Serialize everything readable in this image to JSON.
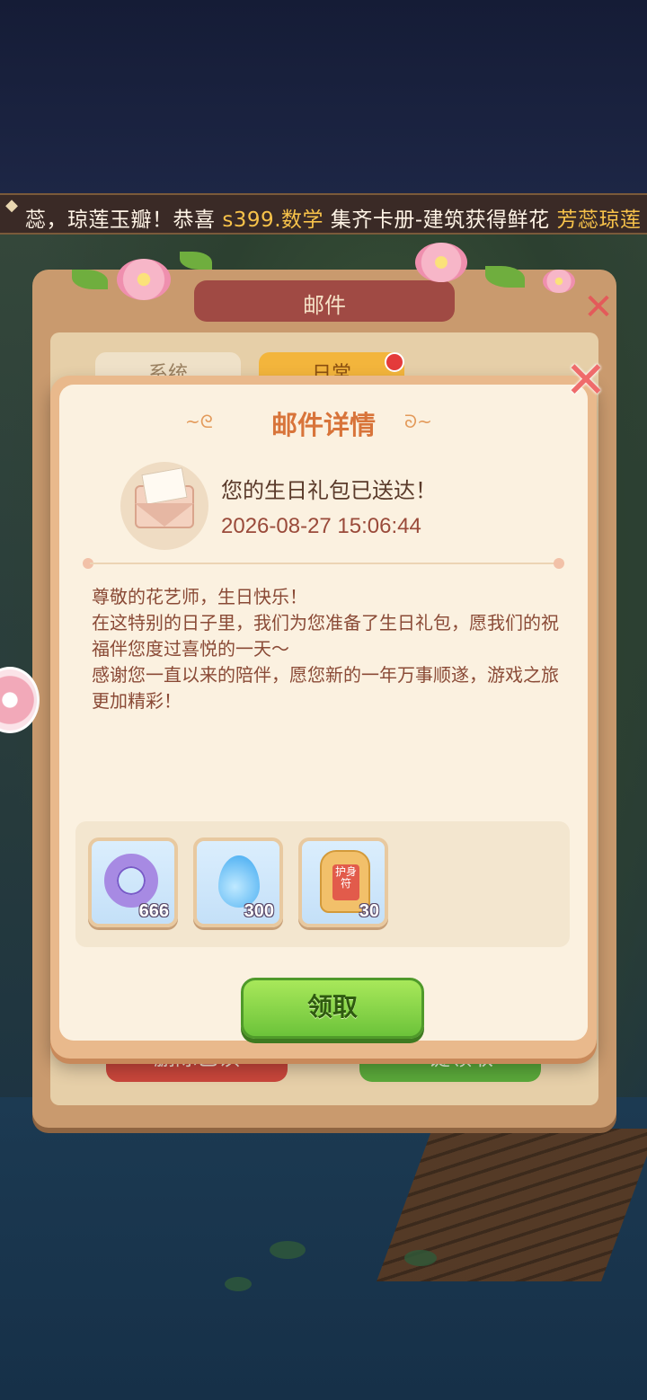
{
  "ticker": {
    "text_prefix": "蕊，琼莲玉瓣！恭喜 ",
    "highlight": "s399.数学",
    "text_middle": " 集齐卡册-建筑获得鲜花 ",
    "highlight2": "芳蕊琼莲"
  },
  "mail_panel": {
    "title": "邮件",
    "tabs": [
      "系统",
      "日常"
    ],
    "buttons": [
      "删除已读",
      "一键领取"
    ]
  },
  "dialog": {
    "title": "邮件详情",
    "subject": "您的生日礼包已送达！",
    "time": "2026-08-27 15:06:44",
    "body_line1": "尊敬的花艺师，生日快乐！",
    "body_line2": "在这特别的日子里，我们为您准备了生日礼包，愿我们的祝福伴您度过喜悦的一天～",
    "body_line3": "感谢您一直以来的陪伴，愿您新的一年万事顺遂，游戏之旅更加精彩！",
    "rewards": [
      {
        "icon": "purple-ring-icon",
        "count": "666"
      },
      {
        "icon": "water-drop-icon",
        "count": "300"
      },
      {
        "icon": "charm-amulet-icon",
        "count": "30",
        "label": "护身符"
      }
    ],
    "claim_label": "领取"
  },
  "colors": {
    "title": "#d8743a",
    "claim_button": "#6cc33a",
    "time_text": "#9a4a3a"
  }
}
